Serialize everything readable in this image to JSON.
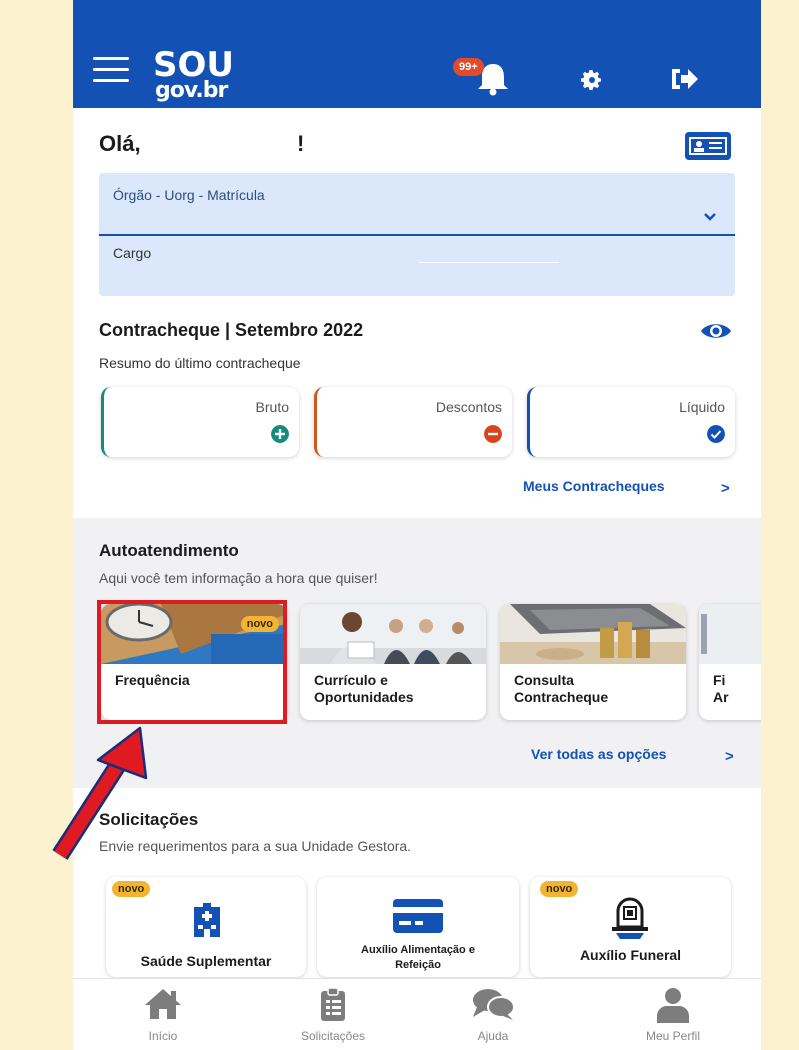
{
  "header": {
    "logo_line1": "SOU",
    "logo_line2": "gov.br",
    "notification_badge": "99+",
    "icons": [
      "menu-icon",
      "bell-icon",
      "gear-icon",
      "logout-icon"
    ],
    "brand_color": "#1351b4"
  },
  "greeting": {
    "hello": "Olá,",
    "excl": "!",
    "field1_label": "Órgão - Uorg - Matrícula",
    "field2_label": "Cargo"
  },
  "payslip": {
    "title": "Contracheque | Setembro 2022",
    "subtitle": "Resumo do último contracheque",
    "cards": [
      {
        "label": "Bruto",
        "icon": "plus-circle-icon",
        "color": "#168b7c"
      },
      {
        "label": "Descontos",
        "icon": "minus-circle-icon",
        "color": "#c85a1f"
      },
      {
        "label": "Líquido",
        "icon": "check-circle-icon",
        "color": "#1351b4"
      }
    ],
    "link": "Meus Contracheques",
    "link_chevron": ">"
  },
  "self_service": {
    "title": "Autoatendimento",
    "subtitle": "Aqui você tem informação a hora que quiser!",
    "items": [
      {
        "name": "Frequência",
        "tag": "novo"
      },
      {
        "name_line1": "Currículo e",
        "name_line2": "Oportunidades"
      },
      {
        "name_line1": "Consulta",
        "name_line2": "Contracheque"
      },
      {
        "name_line1": "Fi",
        "name_line2": "Ar"
      }
    ],
    "link": "Ver todas as opções",
    "link_chevron": ">"
  },
  "requests": {
    "title": "Solicitações",
    "subtitle": "Envie requerimentos para a sua Unidade Gestora.",
    "items": [
      {
        "name": "Saúde Suplementar",
        "tag": "novo",
        "icon": "hospital-icon"
      },
      {
        "name_line1": "Auxílio Alimentação e",
        "name_line2": "Refeição",
        "icon": "card-icon"
      },
      {
        "name": "Auxílio Funeral",
        "tag": "novo",
        "icon": "funeral-icon"
      }
    ]
  },
  "bottom_nav": [
    {
      "label": "Início",
      "icon": "home-icon"
    },
    {
      "label": "Solicitações",
      "icon": "clipboard-icon"
    },
    {
      "label": "Ajuda",
      "icon": "chat-icon"
    },
    {
      "label": "Meu Perfil",
      "icon": "user-icon"
    }
  ],
  "annotation_color": "#e01a22"
}
